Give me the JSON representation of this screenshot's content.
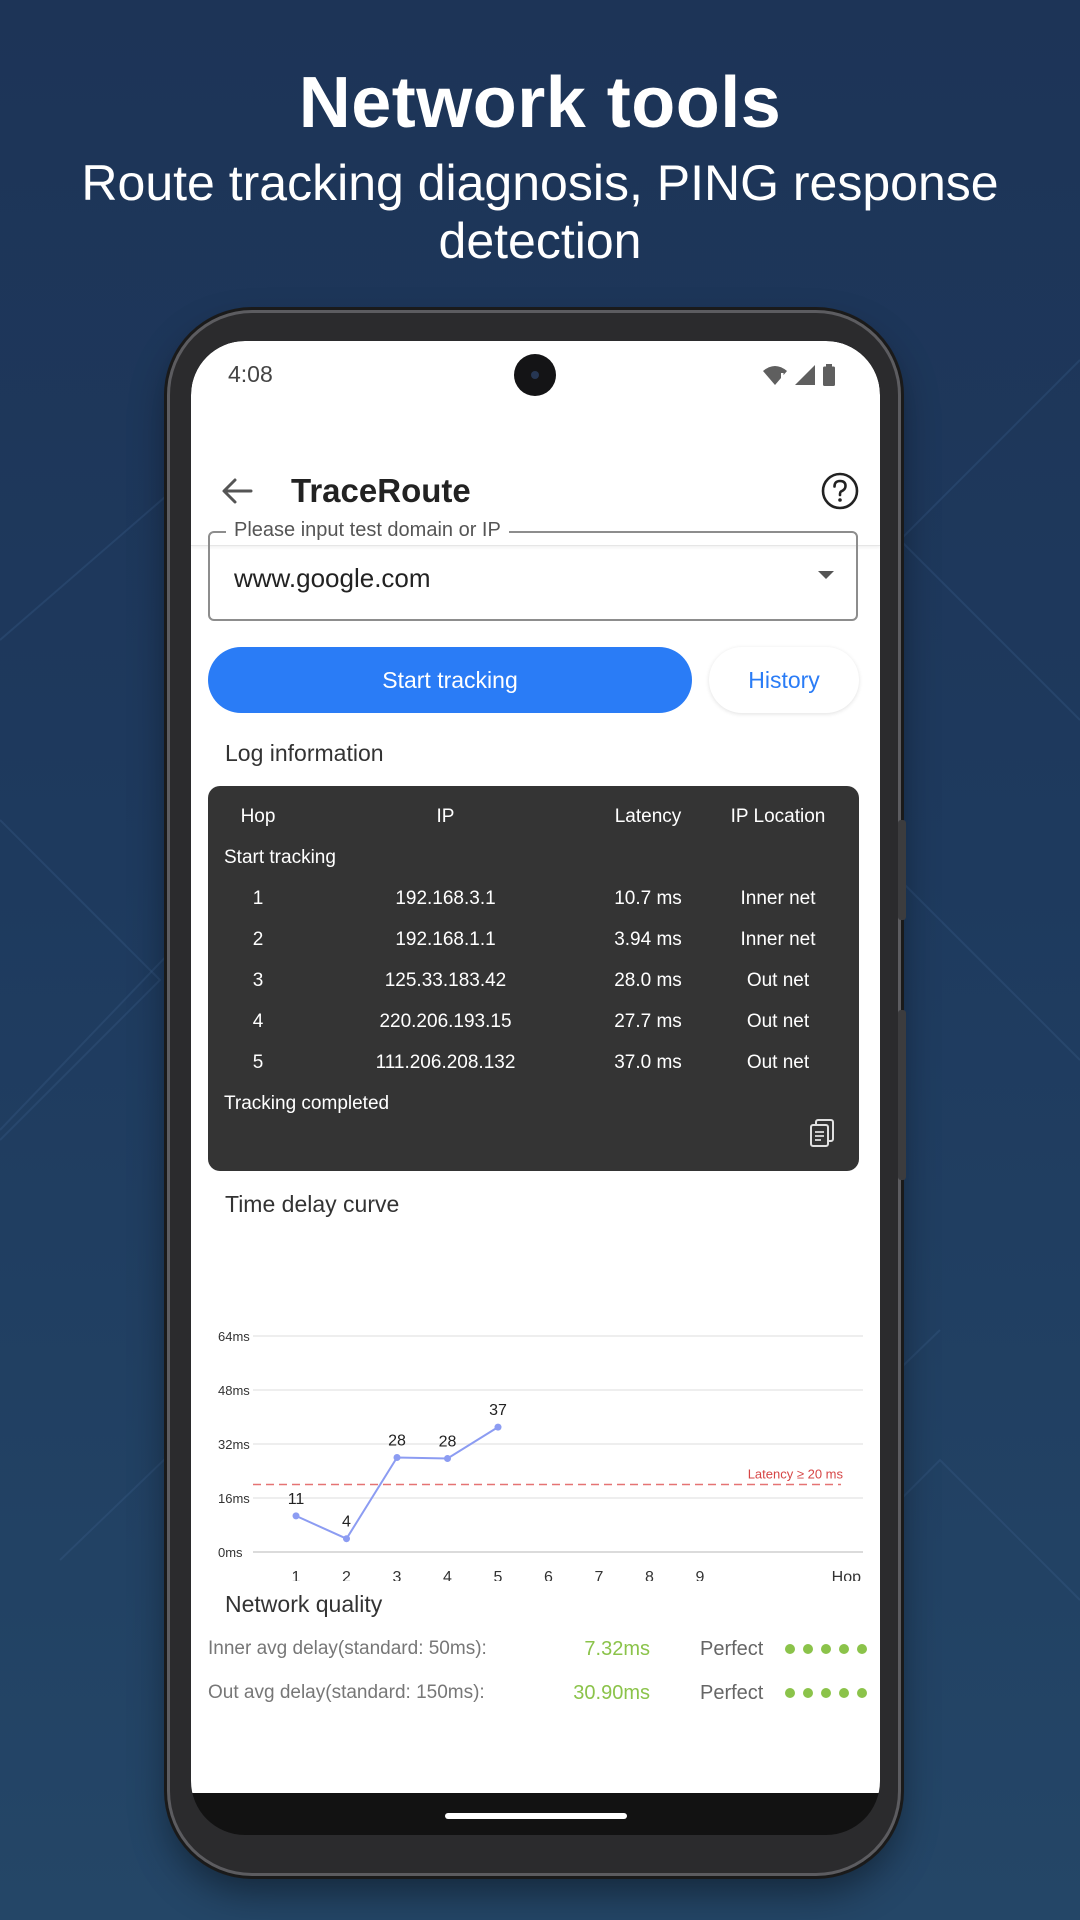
{
  "promo": {
    "title": "Network tools",
    "subtitle": "Route tracking diagnosis, PING response detection"
  },
  "status_bar": {
    "time": "4:08",
    "icons": [
      "wifi-icon",
      "signal-icon",
      "battery-icon"
    ]
  },
  "appbar": {
    "title": "TraceRoute",
    "back_icon": "arrow-left-icon",
    "help_icon": "question-circle-icon"
  },
  "input": {
    "label": "Please input test domain or IP",
    "value": "www.google.com"
  },
  "buttons": {
    "start": "Start tracking",
    "history": "History"
  },
  "log": {
    "section_title": "Log information",
    "headers": [
      "Hop",
      "IP",
      "Latency",
      "IP Location"
    ],
    "start_text": "Start tracking",
    "rows": [
      {
        "hop": "1",
        "ip": "192.168.3.1",
        "latency": "10.7 ms",
        "location": "Inner net"
      },
      {
        "hop": "2",
        "ip": "192.168.1.1",
        "latency": "3.94 ms",
        "location": "Inner net"
      },
      {
        "hop": "3",
        "ip": "125.33.183.42",
        "latency": "28.0 ms",
        "location": "Out net"
      },
      {
        "hop": "4",
        "ip": "220.206.193.15",
        "latency": "27.7 ms",
        "location": "Out net"
      },
      {
        "hop": "5",
        "ip": "111.206.208.132",
        "latency": "37.0 ms",
        "location": "Out net"
      }
    ],
    "end_text": "Tracking completed"
  },
  "chart": {
    "section_title": "Time delay curve"
  },
  "chart_data": {
    "type": "line",
    "x": [
      1,
      2,
      3,
      4,
      5
    ],
    "y": [
      10.7,
      3.94,
      28.0,
      27.7,
      37.0
    ],
    "point_labels": [
      "11",
      "4",
      "28",
      "28",
      "37"
    ],
    "x_ticks": [
      "1",
      "2",
      "3",
      "4",
      "5",
      "6",
      "7",
      "8",
      "9"
    ],
    "x_range": [
      1,
      9
    ],
    "y_ticks": [
      "0ms",
      "16ms",
      "32ms",
      "48ms",
      "64ms"
    ],
    "y_tick_values": [
      0,
      16,
      32,
      48,
      64
    ],
    "ylim": [
      0,
      64
    ],
    "xlabel": "Hop",
    "ylabel": "",
    "threshold": {
      "value": 20,
      "label": "Latency ≥ 20 ms",
      "color": "#e57373"
    },
    "line_color": "#8c9cf2",
    "grid": true
  },
  "quality": {
    "section_title": "Network quality",
    "rows": [
      {
        "label": "Inner avg delay(standard: 50ms):",
        "value": "7.32ms",
        "rating": "Perfect",
        "score": 5,
        "max_score": 5
      },
      {
        "label": "Out avg delay(standard: 150ms):",
        "value": "30.90ms",
        "rating": "Perfect",
        "score": 5,
        "max_score": 5
      }
    ]
  },
  "colors": {
    "accent": "#2a7cf6",
    "good": "#8bc34a",
    "log_bg": "#343434"
  }
}
